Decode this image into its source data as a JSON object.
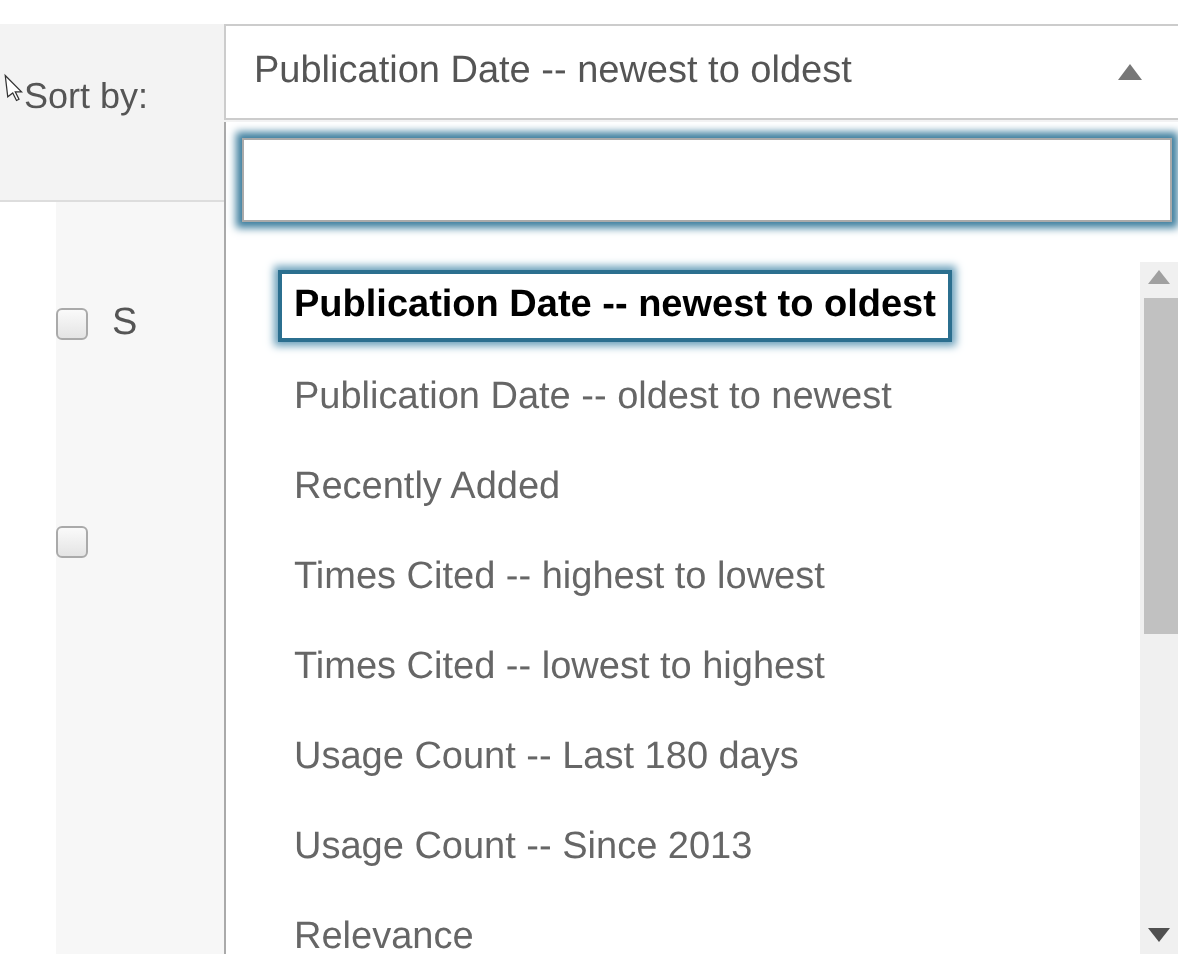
{
  "sort": {
    "label": "Sort by:",
    "value": "Publication Date -- newest to oldest",
    "expanded": true
  },
  "dropdown": {
    "options": [
      {
        "label": "Publication Date -- newest to oldest",
        "selected": true
      },
      {
        "label": "Publication Date -- oldest to newest",
        "selected": false
      },
      {
        "label": "Recently Added",
        "selected": false
      },
      {
        "label": "Times Cited -- highest to lowest",
        "selected": false
      },
      {
        "label": "Times Cited -- lowest to highest",
        "selected": false
      },
      {
        "label": "Usage Count -- Last 180 days",
        "selected": false
      },
      {
        "label": "Usage Count -- Since 2013",
        "selected": false
      },
      {
        "label": "Relevance",
        "selected": false
      }
    ]
  },
  "results": [
    {
      "checked": false,
      "text": "S"
    },
    {
      "checked": false
    }
  ]
}
